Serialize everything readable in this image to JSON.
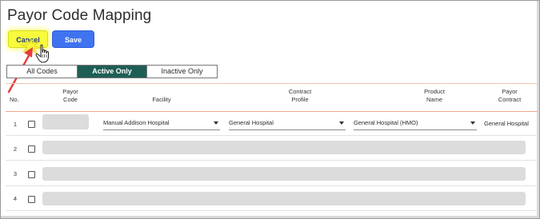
{
  "page": {
    "title": "Payor Code Mapping"
  },
  "actions": {
    "cancel_label": "Cancel",
    "save_label": "Save"
  },
  "filter": {
    "all": "All Codes",
    "active": "Active Only",
    "inactive": "Inactive Only",
    "selected": "Active Only"
  },
  "columns": {
    "no": "No.",
    "payor_code_1": "Payor",
    "payor_code_2": "Code",
    "facility": "Facility",
    "contract_profile_1": "Contract",
    "contract_profile_2": "Profile",
    "product_name_1": "Product",
    "product_name_2": "Name",
    "payor_contract_1": "Payor",
    "payor_contract_2": "Contract"
  },
  "rows": [
    {
      "no": "1",
      "payor_code": "",
      "facility": "Manual Addison Hospital",
      "contract_profile": "General Hospital",
      "product_name": "General Hospital (HMO)",
      "payor_contract": "General Hospital"
    },
    {
      "no": "2"
    },
    {
      "no": "3"
    },
    {
      "no": "4"
    }
  ],
  "colors": {
    "accent": "#1e5e55",
    "save": "#4073f0",
    "cancel_highlight": "#f8fb3c",
    "header_rule": "#f0a585",
    "annotation_arrow": "#e83b3b"
  },
  "icons": {
    "cursor": "hand-pointer-icon",
    "annotation": "red-arrow-annotation"
  }
}
